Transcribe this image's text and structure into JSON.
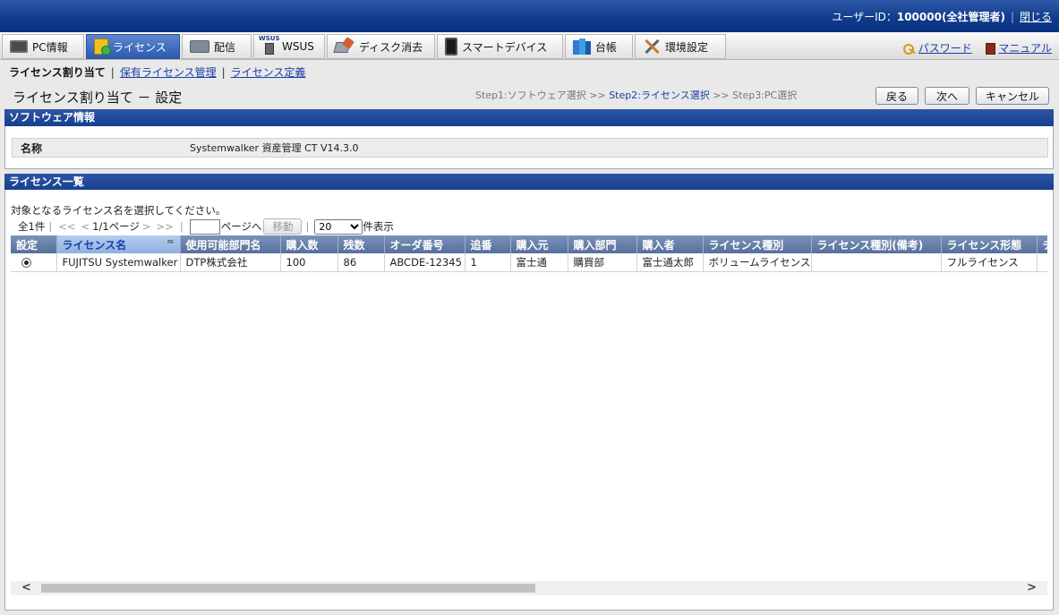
{
  "topbar": {
    "user_label": "ユーザーID：",
    "user_value": "100000(全社管理者)",
    "separator": "|",
    "close_label": "閉じる"
  },
  "menu": {
    "tabs": [
      {
        "label": "PC情報",
        "icon": "pc-icon"
      },
      {
        "label": "ライセンス",
        "icon": "license-icon",
        "active": true
      },
      {
        "label": "配信",
        "icon": "distribution-icon"
      },
      {
        "label": "WSUS",
        "icon": "wsus-icon",
        "icon_text": "WSUS"
      },
      {
        "label": "ディスク消去",
        "icon": "disk-erase-icon"
      },
      {
        "label": "スマートデバイス",
        "icon": "smart-device-icon"
      },
      {
        "label": "台帳",
        "icon": "ledger-icon"
      },
      {
        "label": "環境設定",
        "icon": "settings-tools-icon"
      }
    ],
    "password_label": "パスワード",
    "manual_label": "マニュアル"
  },
  "subnav": {
    "current": "ライセンス割り当て",
    "sep": "|",
    "link1": "保有ライセンス管理",
    "link2": "ライセンス定義"
  },
  "page": {
    "title": "ライセンス割り当て － 設定",
    "step1": "Step1:ソフトウェア選択",
    "arrows": ">>",
    "step2": "Step2:ライセンス選択",
    "step3": "Step3:PC選択",
    "back_label": "戻る",
    "next_label": "次へ",
    "cancel_label": "キャンセル"
  },
  "software": {
    "header": "ソフトウェア情報",
    "name_label": "名称",
    "name_value": "Systemwalker 資産管理 CT V14.3.0"
  },
  "license": {
    "header": "ライセンス一覧",
    "instruction": "対象となるライセンス名を選択してください。",
    "pager": {
      "total": "全1件",
      "sep": "|",
      "first": "<<",
      "prev": "<",
      "pageinfo": "1/1ページ",
      "next": ">",
      "last": ">>",
      "page_suffix": "ページへ",
      "move_label": "移動",
      "per_page_value": "20",
      "per_page_suffix": "件表示"
    },
    "columns": [
      "設定",
      "ライセンス名",
      "使用可能部門名",
      "購入数",
      "残数",
      "オーダ番号",
      "追番",
      "購入元",
      "購入部門",
      "購入者",
      "ライセンス種別",
      "ライセンス種別(備考)",
      "ライセンス形態",
      "チ"
    ],
    "sort_icon": "sort-ascending-icon",
    "sort_glyph": "≈",
    "rows": [
      {
        "selected": true,
        "cells": [
          "FUJITSU Systemwalker",
          "DTP株式会社",
          "100",
          "86",
          "ABCDE-12345",
          "1",
          "富士通",
          "購買部",
          "富士通太郎",
          "ボリュームライセンス",
          "",
          "フルライセンス",
          ""
        ]
      }
    ]
  },
  "scrollbar": {
    "left": "<",
    "right": ">"
  }
}
